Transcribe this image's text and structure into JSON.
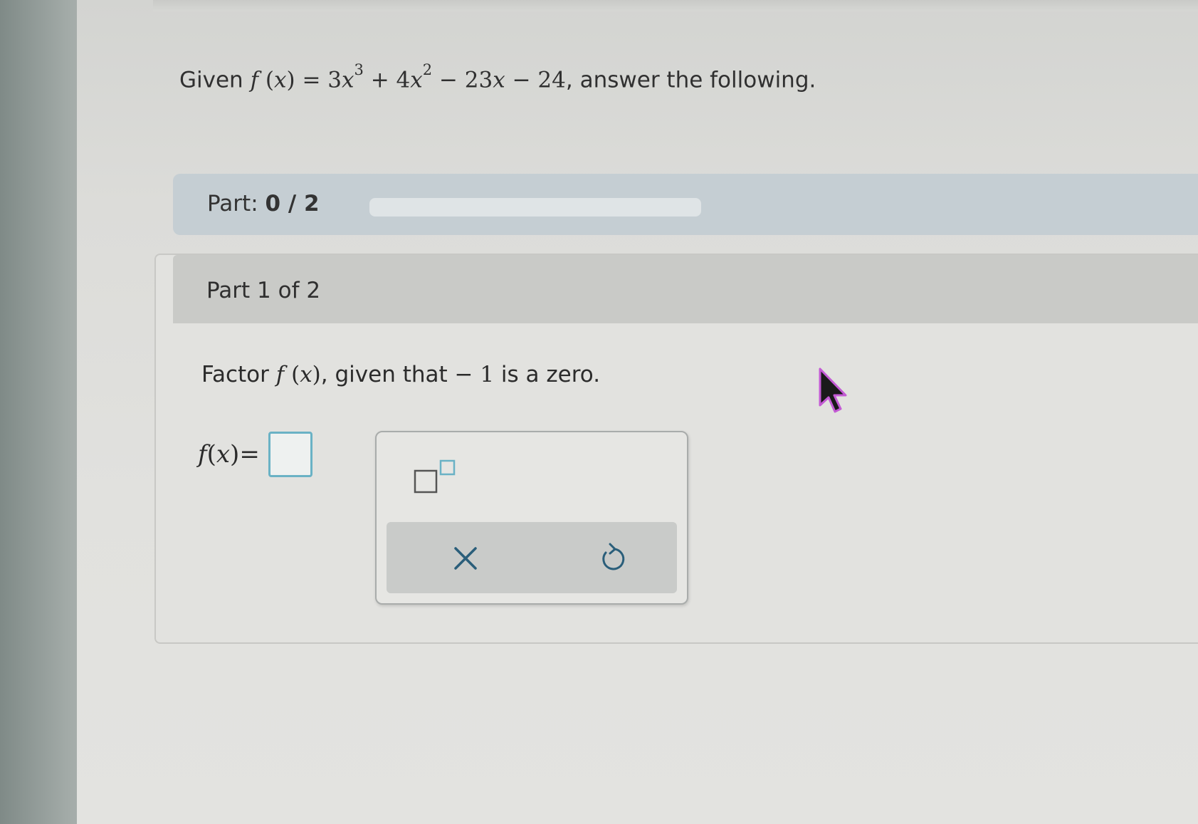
{
  "question": {
    "prefix": "Given ",
    "f": "f",
    "paren_open": " (",
    "x": "x",
    "paren_close": ")",
    "equals_3": " = 3",
    "x1": "x",
    "exp3": "3",
    "plus4": " + 4",
    "x2": "x",
    "exp2": "2",
    "minus23": " − 23",
    "x3": "x",
    "minus24": " − 24",
    "suffix": ", answer the following."
  },
  "progress": {
    "label_prefix": "Part: ",
    "label_value": "0 / 2",
    "completed": 0,
    "total": 2
  },
  "part": {
    "header": "Part 1 of 2",
    "instruction_prefix": "Factor ",
    "f": "f",
    "paren_open": " (",
    "x": "x",
    "paren_close": ")",
    "instruction_mid": ", given that ",
    "zero_value": "− 1",
    "instruction_suffix": " is a zero."
  },
  "answer": {
    "f": "f",
    "paren_open": " (",
    "x": "x",
    "paren_close": ")",
    "equals": " = "
  },
  "palette": {
    "tools": [
      "superscript-icon"
    ],
    "actions": [
      "clear-icon",
      "undo-icon"
    ]
  },
  "colors": {
    "progress_bar_bg": "#c5ced3",
    "answer_box_border": "#6ab2c5",
    "cursor_outline": "#c35ad4"
  }
}
